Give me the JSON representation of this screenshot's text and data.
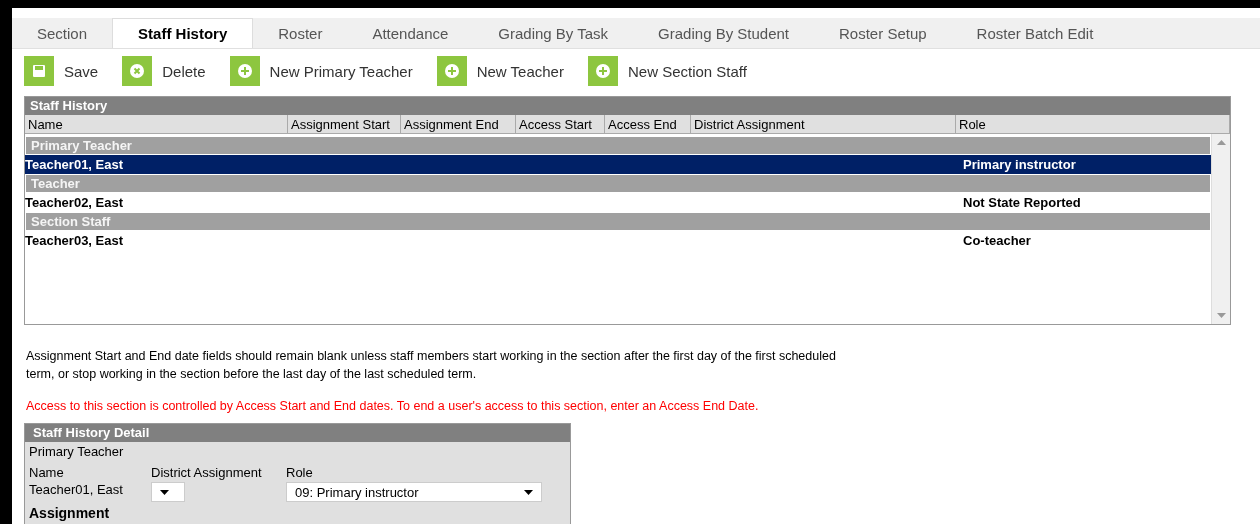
{
  "tabs": [
    {
      "label": "Section",
      "selected": false
    },
    {
      "label": "Staff History",
      "selected": true
    },
    {
      "label": "Roster",
      "selected": false
    },
    {
      "label": "Attendance",
      "selected": false
    },
    {
      "label": "Grading By Task",
      "selected": false
    },
    {
      "label": "Grading By Student",
      "selected": false
    },
    {
      "label": "Roster Setup",
      "selected": false
    },
    {
      "label": "Roster Batch Edit",
      "selected": false
    }
  ],
  "toolbar": [
    {
      "label": "Save",
      "kind": "save"
    },
    {
      "label": "Delete",
      "kind": "delete"
    },
    {
      "label": "New Primary Teacher",
      "kind": "add"
    },
    {
      "label": "New Teacher",
      "kind": "add"
    },
    {
      "label": "New Section Staff",
      "kind": "add"
    }
  ],
  "staff_history": {
    "title": "Staff History",
    "columns": [
      "Name",
      "Assignment Start",
      "Assignment End",
      "Access Start",
      "Access End",
      "District Assignment",
      "Role"
    ],
    "groups": [
      {
        "label": "Primary Teacher",
        "rows": [
          {
            "name": "Teacher01, East",
            "role": "Primary instructor",
            "selected": true
          }
        ]
      },
      {
        "label": "Teacher",
        "rows": [
          {
            "name": "Teacher02, East",
            "role": "Not State Reported",
            "selected": false
          }
        ]
      },
      {
        "label": "Section Staff",
        "rows": [
          {
            "name": "Teacher03, East",
            "role": "Co-teacher",
            "selected": false
          }
        ]
      }
    ]
  },
  "notes": [
    {
      "kind": "info",
      "text": "Assignment Start and End date fields should remain blank unless staff members start working in the section after the first day of the first scheduled term, or stop working in the section before the last day of the last scheduled term."
    },
    {
      "kind": "warning",
      "text": "Access to this section is controlled by Access Start and End dates. To end a user's access to this section, enter an Access End Date."
    }
  ],
  "detail": {
    "title": "Staff History Detail",
    "group_label": "Primary Teacher",
    "name_label": "Name",
    "name_value": "Teacher01, East",
    "district_label": "District Assignment",
    "role_label": "Role",
    "role_value": "09: Primary instructor",
    "section_heading": "Assignment"
  }
}
